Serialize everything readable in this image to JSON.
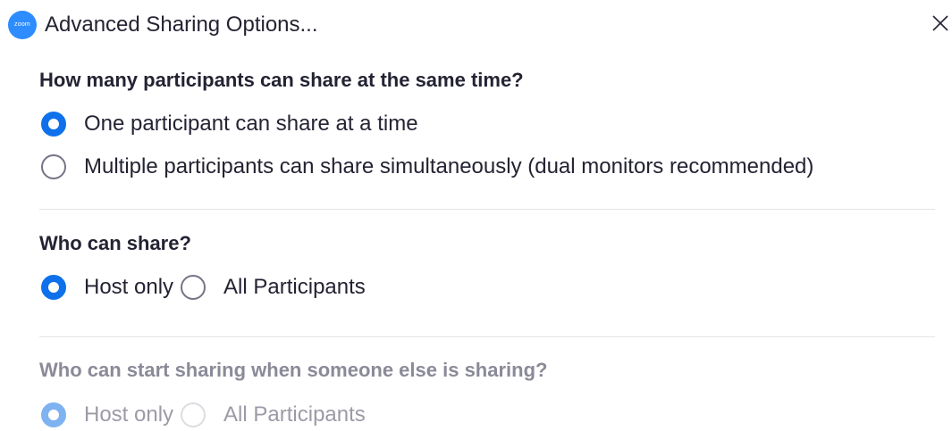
{
  "window": {
    "logo_text": "zoom",
    "title": "Advanced Sharing Options...",
    "close_icon": "close-icon"
  },
  "colors": {
    "accent": "#0E71EB",
    "brand": "#2D8CFF",
    "text": "#232333",
    "disabled_text": "#8a8a98"
  },
  "sections": {
    "simultaneous": {
      "heading": "How many participants can share at the same time?",
      "options": [
        {
          "label": "One participant can share at a time",
          "selected": true
        },
        {
          "label": "Multiple participants can share simultaneously (dual monitors recommended)",
          "selected": false
        }
      ]
    },
    "who_can_share": {
      "heading": "Who can share?",
      "options": [
        {
          "label": "Host only",
          "selected": true
        },
        {
          "label": "All Participants",
          "selected": false
        }
      ]
    },
    "start_while_sharing": {
      "heading": "Who can start sharing when someone else is sharing?",
      "disabled": true,
      "options": [
        {
          "label": "Host only",
          "selected": true
        },
        {
          "label": "All Participants",
          "selected": false
        }
      ]
    }
  }
}
